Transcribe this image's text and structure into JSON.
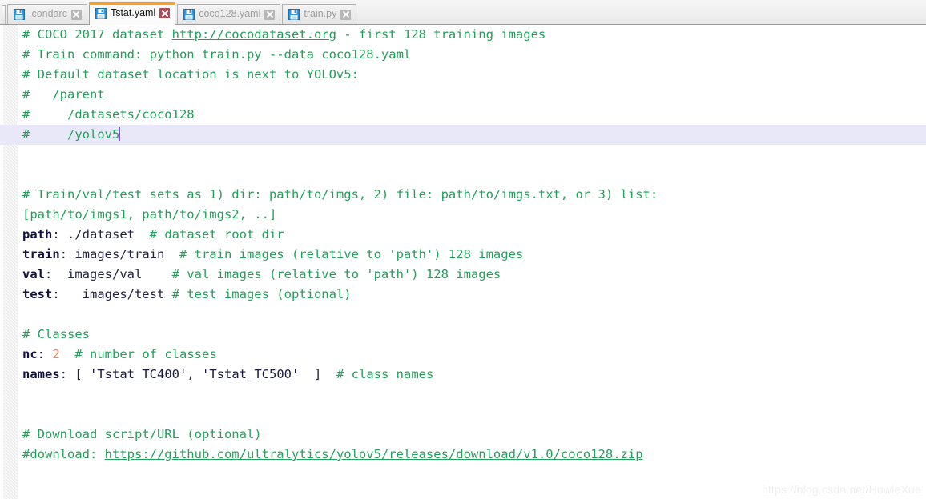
{
  "window": {
    "title": "Tstat.yaml"
  },
  "tabbar": {
    "tabs": [
      {
        "label": ".condarc",
        "icon": "save-icon",
        "close_icon": "close-icon",
        "active": false
      },
      {
        "label": "Tstat.yaml",
        "icon": "save-icon",
        "close_icon": "close-icon",
        "active": true
      },
      {
        "label": "coco128.yaml",
        "icon": "save-icon",
        "close_icon": "close-icon",
        "active": false
      },
      {
        "label": "train.py",
        "icon": "save-icon",
        "close_icon": "close-icon",
        "active": false
      }
    ],
    "active_tab_accent": "#ff9c22",
    "active_close_color": "#b04a55"
  },
  "editor": {
    "language": "yaml",
    "current_line_number": 6,
    "colors": {
      "comment": "#22a05a",
      "key": "#131340",
      "value": "#202040",
      "number": "#f08a5d",
      "string": "#1a1a3d",
      "current_line_bg": "#e8e8f9",
      "caret": "#8a4fd6",
      "gutter_bg": "#ededed",
      "background": "#ffffff"
    },
    "lines": [
      {
        "n": 1,
        "current": false,
        "parts": [
          {
            "t": "comment",
            "s": "# COCO 2017 dataset "
          },
          {
            "t": "comment-link",
            "s": "http://cocodataset.org"
          },
          {
            "t": "comment",
            "s": " - first 128 training images"
          }
        ]
      },
      {
        "n": 2,
        "current": false,
        "parts": [
          {
            "t": "comment",
            "s": "# Train command: python train.py --data coco128.yaml"
          }
        ]
      },
      {
        "n": 3,
        "current": false,
        "parts": [
          {
            "t": "comment",
            "s": "# Default dataset location is next to YOLOv5:"
          }
        ]
      },
      {
        "n": 4,
        "current": false,
        "parts": [
          {
            "t": "comment",
            "s": "#   /parent"
          }
        ]
      },
      {
        "n": 5,
        "current": false,
        "parts": [
          {
            "t": "comment",
            "s": "#     /datasets/coco128"
          }
        ]
      },
      {
        "n": 6,
        "current": true,
        "parts": [
          {
            "t": "comment",
            "s": "#     /yolov5"
          },
          {
            "t": "caret",
            "s": ""
          }
        ]
      },
      {
        "n": 7,
        "current": false,
        "parts": []
      },
      {
        "n": 8,
        "current": false,
        "parts": []
      },
      {
        "n": 9,
        "current": false,
        "parts": [
          {
            "t": "comment",
            "s": "# Train/val/test sets as 1) dir: path/to/imgs, 2) file: path/to/imgs.txt, or 3) list:"
          }
        ]
      },
      {
        "n": 10,
        "current": false,
        "parts": [
          {
            "t": "comment",
            "s": "[path/to/imgs1, path/to/imgs2, ..]"
          }
        ]
      },
      {
        "n": 11,
        "current": false,
        "parts": [
          {
            "t": "key",
            "s": "path"
          },
          {
            "t": "value",
            "s": ": ./dataset  "
          },
          {
            "t": "comment",
            "s": "# dataset root dir"
          }
        ]
      },
      {
        "n": 12,
        "current": false,
        "parts": [
          {
            "t": "key",
            "s": "train"
          },
          {
            "t": "value",
            "s": ": images/train  "
          },
          {
            "t": "comment",
            "s": "# train images (relative to 'path') 128 images"
          }
        ]
      },
      {
        "n": 13,
        "current": false,
        "parts": [
          {
            "t": "key",
            "s": "val"
          },
          {
            "t": "value",
            "s": ":  images/val    "
          },
          {
            "t": "comment",
            "s": "# val images (relative to 'path') 128 images"
          }
        ]
      },
      {
        "n": 14,
        "current": false,
        "parts": [
          {
            "t": "key",
            "s": "test"
          },
          {
            "t": "value",
            "s": ":   images/test "
          },
          {
            "t": "comment",
            "s": "# test images (optional)"
          }
        ]
      },
      {
        "n": 15,
        "current": false,
        "parts": []
      },
      {
        "n": 16,
        "current": false,
        "parts": [
          {
            "t": "comment",
            "s": "# Classes"
          }
        ]
      },
      {
        "n": 17,
        "current": false,
        "parts": [
          {
            "t": "key",
            "s": "nc"
          },
          {
            "t": "value",
            "s": ": "
          },
          {
            "t": "number",
            "s": "2"
          },
          {
            "t": "value",
            "s": "  "
          },
          {
            "t": "comment",
            "s": "# number of classes"
          }
        ]
      },
      {
        "n": 18,
        "current": false,
        "parts": [
          {
            "t": "key",
            "s": "names"
          },
          {
            "t": "value",
            "s": ": [ "
          },
          {
            "t": "string",
            "s": "'Tstat_TC400'"
          },
          {
            "t": "value",
            "s": ", "
          },
          {
            "t": "string",
            "s": "'Tstat_TC500'"
          },
          {
            "t": "value",
            "s": "  ]  "
          },
          {
            "t": "comment",
            "s": "# class names"
          }
        ]
      },
      {
        "n": 19,
        "current": false,
        "parts": []
      },
      {
        "n": 20,
        "current": false,
        "parts": []
      },
      {
        "n": 21,
        "current": false,
        "parts": [
          {
            "t": "comment",
            "s": "# Download script/URL (optional)"
          }
        ]
      },
      {
        "n": 22,
        "current": false,
        "parts": [
          {
            "t": "comment",
            "s": "#download: "
          },
          {
            "t": "comment-link",
            "s": "https://github.com/ultralytics/yolov5/releases/download/v1.0/coco128.zip"
          }
        ]
      }
    ]
  },
  "watermark": {
    "text": "https://blog.csdn.net/HowieXue"
  }
}
